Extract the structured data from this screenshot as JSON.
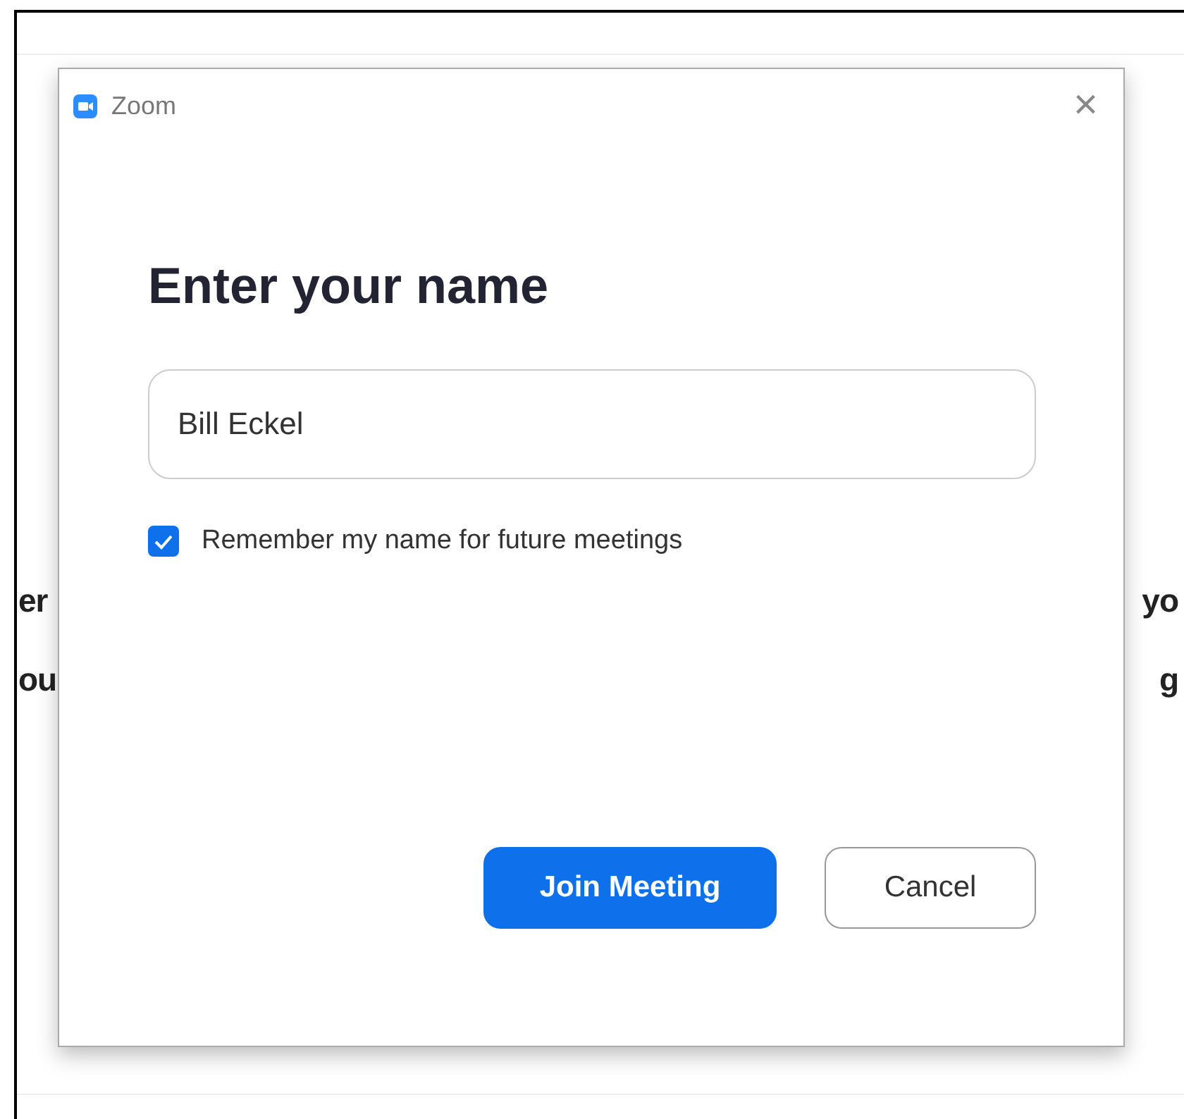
{
  "background": {
    "lines": [
      {
        "left": "er",
        "right": "yo"
      },
      {
        "left": "ou",
        "right": "g"
      }
    ]
  },
  "dialog": {
    "title": "Zoom",
    "close": "×",
    "heading": "Enter your name",
    "name_field": {
      "value": "Bill Eckel"
    },
    "remember": {
      "label": "Remember my name for future meetings",
      "checked": true
    },
    "buttons": [
      {
        "label": "Join Meeting",
        "kind": "primary"
      },
      {
        "label": "Cancel",
        "kind": "secondary"
      }
    ]
  }
}
